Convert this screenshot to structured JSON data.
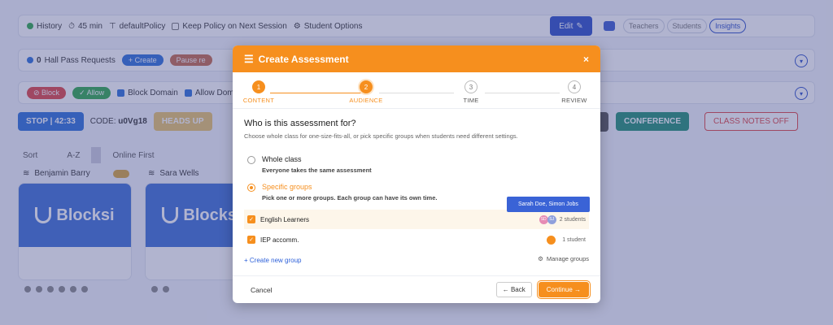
{
  "topbar": {
    "history": "History",
    "duration": "45 min",
    "policy": "defaultPolicy",
    "keep_policy": "Keep Policy on Next Session",
    "student_options": "Student Options",
    "edit": "Edit",
    "tabs": [
      "Teachers",
      "Students",
      "Insights"
    ]
  },
  "hallpass": {
    "count": "0",
    "label": "Hall Pass Requests",
    "create": "+ Create",
    "pause": "Pause re"
  },
  "blockbar": {
    "block": "⊘ Block",
    "allow": "✓ Allow",
    "block_domain": "Block Domain",
    "allow_domain": "Allow Dom"
  },
  "controls": {
    "stop": "STOP | 42:33",
    "code_label": "CODE:",
    "code_value": "u0Vg18",
    "heads_up": "HEADS UP",
    "conference": "CONFERENCE",
    "class_notes": "CLASS NOTES OFF"
  },
  "sort": {
    "label": "Sort",
    "az": "A-Z",
    "online_first": "Online First"
  },
  "students": [
    {
      "name": "Benjamin Barry",
      "logo": "Blocksi"
    },
    {
      "name": "Sara Wells",
      "logo": "Blocksi"
    }
  ],
  "modal": {
    "title": "Create Assessment",
    "close": "×",
    "steps": [
      {
        "num": "1",
        "label": "CONTENT"
      },
      {
        "num": "2",
        "label": "AUDIENCE"
      },
      {
        "num": "3",
        "label": "TIME"
      },
      {
        "num": "4",
        "label": "REVIEW"
      }
    ],
    "question": "Who is this assessment for?",
    "hint": "Choose whole class for one-size-fits-all, or pick specific groups when students need different settings.",
    "whole_class": {
      "title": "Whole class",
      "sub": "Everyone takes the same assessment"
    },
    "specific": {
      "title": "Specific groups",
      "sub": "Pick one or more groups. Each group can have its own time."
    },
    "tooltip": "Sarah Doe, Simon Jobs",
    "groups": [
      {
        "name": "English Learners",
        "count": "2 students",
        "avatars": [
          "SD",
          "SJ"
        ]
      },
      {
        "name": "IEP accomm.",
        "count": "1 student",
        "avatars": [
          ""
        ]
      }
    ],
    "create_group": "+ Create new group",
    "manage_groups": "Manage groups",
    "cancel": "Cancel",
    "back": "← Back",
    "continue": "Continue →"
  }
}
